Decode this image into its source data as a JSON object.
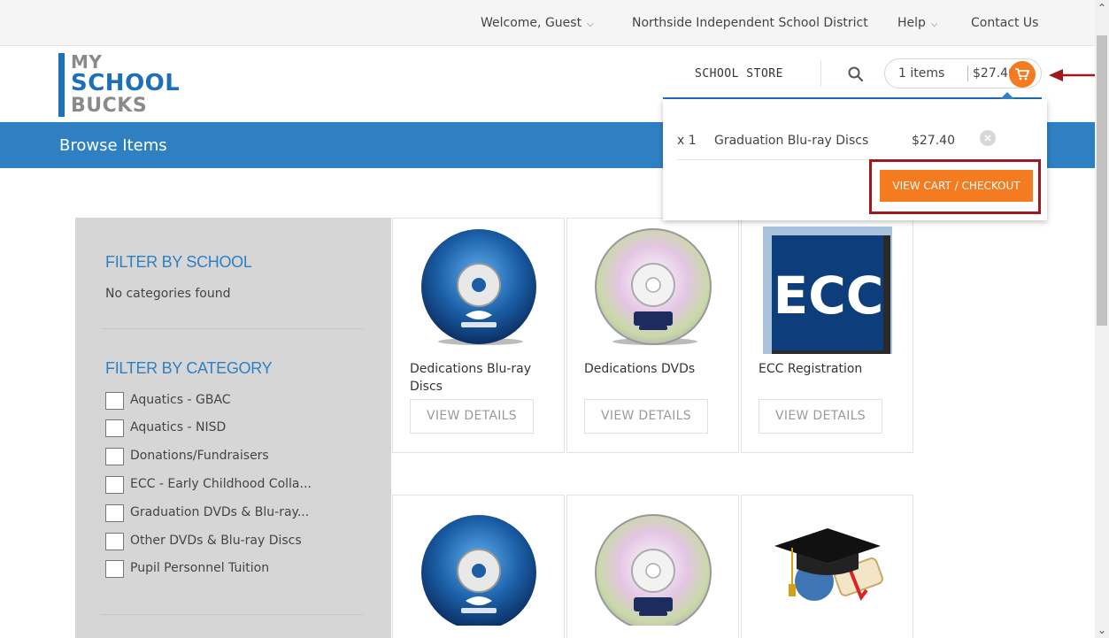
{
  "top_nav": {
    "welcome": "Welcome, Guest",
    "district": "Northside Independent School District",
    "help": "Help",
    "contact": "Contact Us"
  },
  "logo": {
    "line1": "MY",
    "line2": "SCHOOL",
    "line3": "BUCKS"
  },
  "header": {
    "store_link": "SCHOOL STORE",
    "cart_count": "1 items",
    "cart_total": "$27.40"
  },
  "band": {
    "title": "Browse Items"
  },
  "cart_dropdown": {
    "qty": "x 1",
    "item_name": "Graduation Blu-ray Discs",
    "item_price": "$27.40",
    "checkout_label": "VIEW CART / CHECKOUT"
  },
  "filters": {
    "school_heading": "FILTER BY SCHOOL",
    "school_empty": "No categories found",
    "category_heading": "FILTER BY CATEGORY",
    "categories": [
      "Aquatics - GBAC",
      "Aquatics - NISD",
      "Donations/Fundraisers",
      "ECC - Early Childhood Colla...",
      "Graduation DVDs & Blu-ray...",
      "Other DVDs & Blu-ray Discs",
      "Pupil Personnel Tuition"
    ]
  },
  "products": [
    {
      "name": "Dedications Blu-ray Discs",
      "button": "VIEW DETAILS",
      "icon": "blu-ray-disc"
    },
    {
      "name": "Dedications DVDs",
      "button": "VIEW DETAILS",
      "icon": "dvd-disc"
    },
    {
      "name": "ECC Registration",
      "button": "VIEW DETAILS",
      "icon": "ecc-logo",
      "logo_text": "ECC"
    },
    {
      "name": "",
      "button": "",
      "icon": "blu-ray-disc"
    },
    {
      "name": "",
      "button": "",
      "icon": "dvd-disc"
    },
    {
      "name": "",
      "button": "",
      "icon": "graduation-cap"
    }
  ],
  "colors": {
    "brand_blue": "#2f80c3",
    "accent_orange": "#f47b20",
    "highlight_red": "#a0191e"
  }
}
